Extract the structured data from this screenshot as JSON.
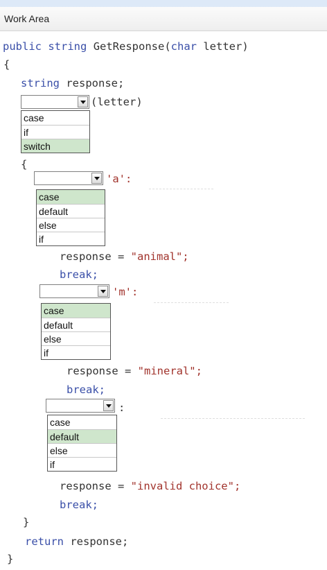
{
  "window": {
    "title": "Work Area"
  },
  "code": {
    "sig_kw1": "public",
    "sig_kw2": "string",
    "sig_name": "GetResponse(",
    "sig_kw3": "char",
    "sig_rest": "letter)",
    "open_brace": "{",
    "decl_type": "string",
    "decl_rest": "response;",
    "switch_tail": "(letter)",
    "inner_open": "{",
    "case_a_tail": "'a':",
    "assign1_lhs": "response = ",
    "assign1_val": "\"animal\";",
    "break1": "break;",
    "case_m_tail": "'m':",
    "assign2_lhs": "response = ",
    "assign2_val": "\"mineral\";",
    "break2": "break;",
    "default_tail": ":",
    "assign3_lhs": "response = ",
    "assign3_val": "\"invalid choice\";",
    "break3": "break;",
    "inner_close": "}",
    "return_kw": "return",
    "return_rest": "response;",
    "close_brace": "}"
  },
  "dropdowns": [
    {
      "options": [
        "case",
        "if",
        "switch"
      ],
      "selected": "switch"
    },
    {
      "options": [
        "case",
        "default",
        "else",
        "if"
      ],
      "selected": "case"
    },
    {
      "options": [
        "case",
        "default",
        "else",
        "if"
      ],
      "selected": "case"
    },
    {
      "options": [
        "case",
        "default",
        "else",
        "if"
      ],
      "selected": "default"
    }
  ],
  "colors": {
    "keyword": "#3a4fa8",
    "string": "#a1332c",
    "selected_option": "#cfe6cc"
  }
}
